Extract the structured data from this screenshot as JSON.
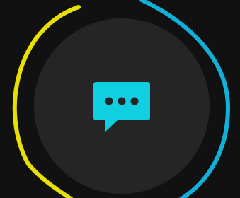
{
  "theme": {
    "background": "#111111",
    "disc_color": "#252525",
    "left_arc_color": "#e8e000",
    "right_arc_color": "#12b0d8",
    "bubble_color": "#0fcfe0",
    "dots_color": "#252525"
  },
  "button": {
    "icon": "chat-bubble-ellipsis-icon"
  }
}
